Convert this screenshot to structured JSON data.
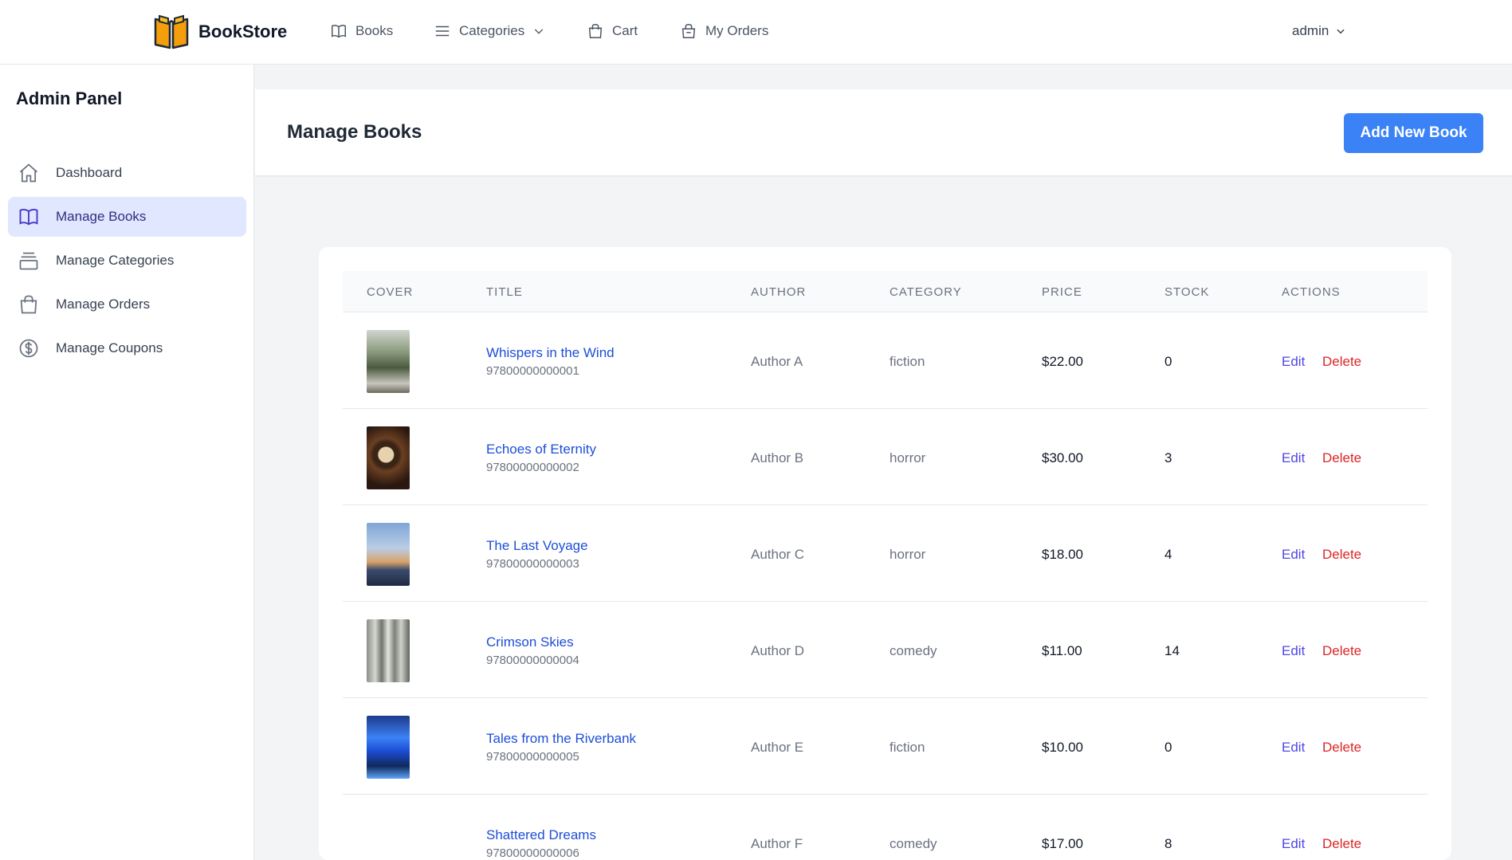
{
  "brand": {
    "name": "BookStore",
    "logo_icon": "open-book-logo-icon",
    "logo_color": "#f59e0b"
  },
  "nav": {
    "books": "Books",
    "categories": "Categories",
    "cart": "Cart",
    "orders": "My Orders",
    "user": "admin"
  },
  "sidebar": {
    "title": "Admin Panel",
    "items": [
      {
        "label": "Dashboard",
        "icon": "home-icon"
      },
      {
        "label": "Manage Books",
        "icon": "book-icon",
        "active": true
      },
      {
        "label": "Manage Categories",
        "icon": "archive-icon"
      },
      {
        "label": "Manage Orders",
        "icon": "shopping-bag-icon"
      },
      {
        "label": "Manage Coupons",
        "icon": "dollar-circle-icon"
      }
    ]
  },
  "header": {
    "title": "Manage Books",
    "add_button": "Add New Book"
  },
  "table": {
    "columns": {
      "cover": "COVER",
      "title": "TITLE",
      "author": "AUTHOR",
      "category": "CATEGORY",
      "price": "PRICE",
      "stock": "STOCK",
      "actions": "ACTIONS"
    },
    "edit_label": "Edit",
    "delete_label": "Delete",
    "rows": [
      {
        "title": "Whispers in the Wind",
        "isbn": "97800000000001",
        "author": "Author A",
        "category": "fiction",
        "price": "$22.00",
        "stock": "0"
      },
      {
        "title": "Echoes of Eternity",
        "isbn": "97800000000002",
        "author": "Author B",
        "category": "horror",
        "price": "$30.00",
        "stock": "3"
      },
      {
        "title": "The Last Voyage",
        "isbn": "97800000000003",
        "author": "Author C",
        "category": "horror",
        "price": "$18.00",
        "stock": "4"
      },
      {
        "title": "Crimson Skies",
        "isbn": "97800000000004",
        "author": "Author D",
        "category": "comedy",
        "price": "$11.00",
        "stock": "14"
      },
      {
        "title": "Tales from the Riverbank",
        "isbn": "97800000000005",
        "author": "Author E",
        "category": "fiction",
        "price": "$10.00",
        "stock": "0"
      },
      {
        "title": "Shattered Dreams",
        "isbn": "97800000000006",
        "author": "Author F",
        "category": "comedy",
        "price": "$17.00",
        "stock": "8"
      }
    ]
  },
  "colors": {
    "primary": "#3b82f6",
    "link": "#1d4ed8",
    "edit": "#4f46e5",
    "delete": "#dc2626",
    "active_bg": "#e0e7ff"
  }
}
